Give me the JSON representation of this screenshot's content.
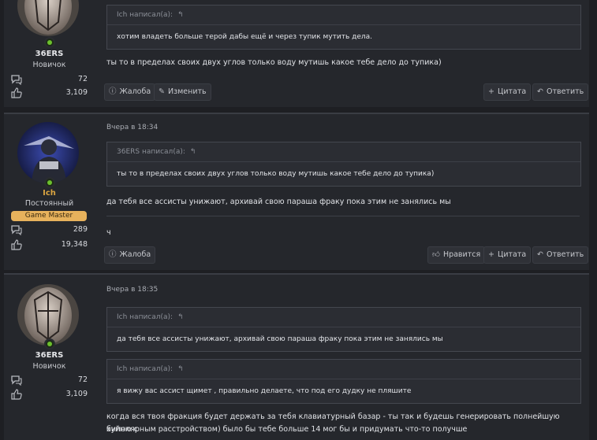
{
  "posts": [
    {
      "username": "36ERS",
      "title": "Новичок",
      "messages_count": "72",
      "reactions_count": "3,109",
      "date": "",
      "quotes": [
        {
          "head": "Ich написал(а):",
          "body": "хотим владеть больше терой дабы ещё и через тупик мутить дела."
        }
      ],
      "message": "ты то в пределах своих двух углов только воду мутишь какое тебе дело до тупика)",
      "signature": "",
      "buttons": {
        "report": "Жалоба",
        "edit": "Изменить",
        "quote": "Цитата",
        "reply": "Ответить"
      }
    },
    {
      "username": "Ich",
      "title": "Постоянный",
      "badge": "Game Master",
      "messages_count": "289",
      "reactions_count": "19,348",
      "date": "Вчера в 18:34",
      "quotes": [
        {
          "head": "36ERS написал(а):",
          "body": "ты то в пределах своих двух углов только воду мутишь какое тебе дело до тупика)"
        }
      ],
      "message": "да тебя все ассисты унижают, архивай свою параша фраку пока этим не занялись мы",
      "signature": "ч",
      "buttons": {
        "report": "Жалоба",
        "like": "Нравится",
        "quote": "Цитата",
        "reply": "Ответить"
      }
    },
    {
      "username": "36ERS",
      "title": "Новичок",
      "messages_count": "72",
      "reactions_count": "3,109",
      "date": "Вчера в 18:35",
      "quotes": [
        {
          "head": "Ich написал(а):",
          "body": "да тебя все ассисты унижают, архивай свою параша фраку пока этим не занялись мы"
        },
        {
          "head": "Ich написал(а):",
          "body": "я вижу вас ассист щимет , правильно делаете, что под его дудку не пляшите"
        }
      ],
      "message_line1": "когда вся твоя фракция будет держать за тебя клавиатурный базар - ты так и будешь генерировать полнейшую хуйню с",
      "message_line2": "биполярным расстройством) было бы тебе больше 14 мог бы и придумать что-то получше"
    }
  ],
  "icons": {
    "quote_arrow": "reply-arrow-icon",
    "messages": "messages-icon",
    "reactions": "thumbs-up-icon",
    "report": "alert-circle-icon",
    "edit": "pencil-icon",
    "like": "thumbs-up-icon",
    "quote": "plus-icon",
    "reply": "reply-icon",
    "online": "online-indicator-icon"
  },
  "colors": {
    "background": "#1e1f23",
    "post_bg": "#25272c",
    "online": "#6cc02d",
    "badge_bg": "#e7b25c",
    "gm_name": "#d9a441"
  }
}
